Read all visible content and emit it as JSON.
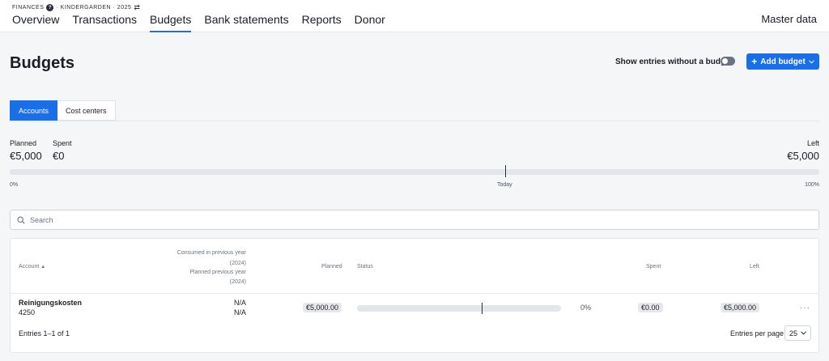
{
  "header": {
    "org": "FINANCES",
    "breadcrumb": "· KINDERGARDEN · 2025",
    "tabs": [
      {
        "label": "Overview"
      },
      {
        "label": "Transactions"
      },
      {
        "label": "Budgets",
        "active": true
      },
      {
        "label": "Bank statements"
      },
      {
        "label": "Reports"
      },
      {
        "label": "Donor"
      }
    ],
    "master_data": "Master data"
  },
  "page": {
    "title": "Budgets",
    "toggle_label": "Show entries without a budget",
    "toggle_on": false,
    "add_button": "Add budget"
  },
  "segments": [
    {
      "label": "Accounts",
      "active": true
    },
    {
      "label": "Cost centers",
      "active": false
    }
  ],
  "summary": {
    "planned_label": "Planned",
    "planned_value": "€5,000",
    "spent_label": "Spent",
    "spent_value": "€0",
    "left_label": "Left",
    "left_value": "€5,000",
    "progress_spent_fraction": 0,
    "today_fraction": 0.612,
    "tick_start": "0%",
    "tick_today": "Today",
    "tick_end": "100%"
  },
  "search": {
    "placeholder": "Search"
  },
  "table": {
    "headers": {
      "account": "Account",
      "consumed_prev_1": "Consumed in previous year",
      "consumed_prev_2": "(2024)",
      "planned_prev_1": "Planned previous year",
      "planned_prev_2": "(2024)",
      "planned": "Planned",
      "status": "Status",
      "spent": "Spent",
      "left": "Left"
    },
    "rows": [
      {
        "account_name": "Reinigungskosten",
        "account_number": "4250",
        "consumed_prev": "N/A",
        "planned_prev": "N/A",
        "planned": "€5,000.00",
        "status_percent": "0%",
        "status_fraction": 0,
        "spent": "€0.00",
        "left": "€5,000.00"
      }
    ],
    "entries_info": "Entries 1–1 of 1",
    "per_page_label": "Entries per page",
    "per_page_value": "25"
  },
  "colors": {
    "accent": "#1a6ee6"
  }
}
